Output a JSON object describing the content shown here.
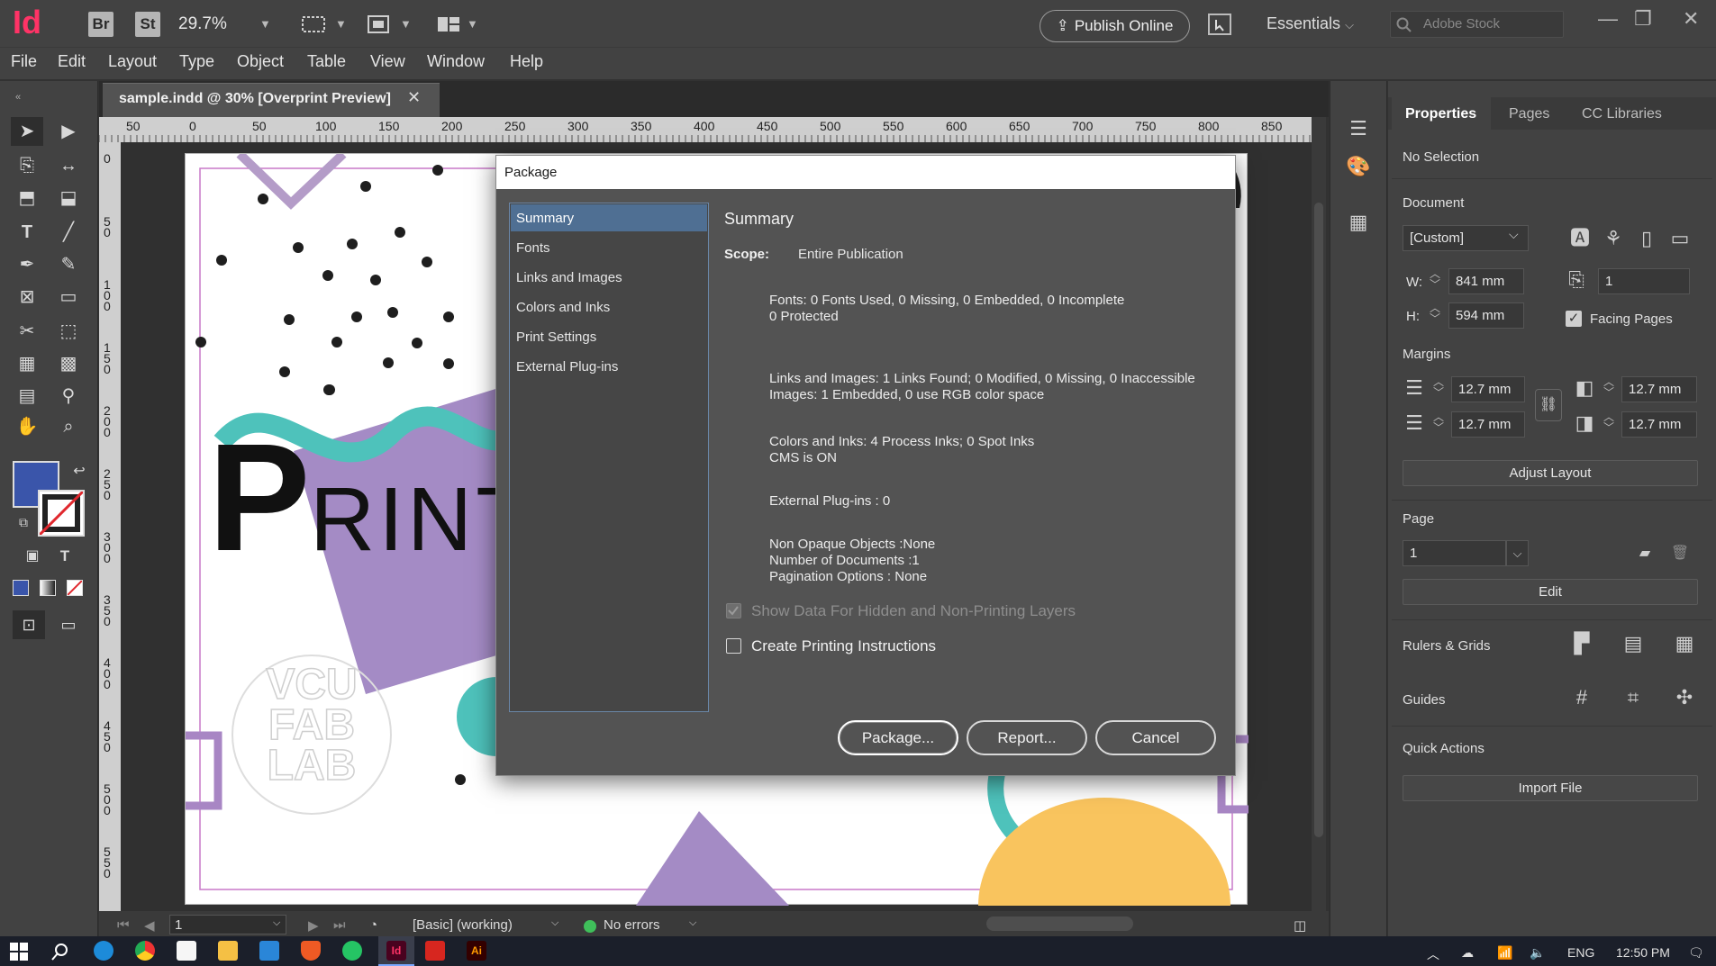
{
  "app": {
    "logo": "Id",
    "bridge": "Br",
    "stock_btn": "St",
    "zoom": "29.7%",
    "publish_online": "Publish Online",
    "workspace": "Essentials",
    "search_placeholder": "Adobe Stock"
  },
  "menu": [
    "File",
    "Edit",
    "Layout",
    "Type",
    "Object",
    "Table",
    "View",
    "Window",
    "Help"
  ],
  "document": {
    "tab_title": "sample.indd @ 30% [Overprint Preview]",
    "ruler_top": [
      "50",
      "0",
      "50",
      "100",
      "150",
      "200",
      "250",
      "300",
      "350",
      "400",
      "450",
      "500",
      "550",
      "600",
      "650",
      "700",
      "750",
      "800",
      "850"
    ],
    "ruler_left": [
      "0",
      "50",
      "100",
      "150",
      "200",
      "250",
      "300",
      "350",
      "400",
      "450",
      "500",
      "550"
    ],
    "artwork_text_print": "PRINT",
    "artwork_text_logo": [
      "VCU",
      "FAB",
      "LAB"
    ]
  },
  "status": {
    "page": "1",
    "style": "[Basic] (working)",
    "errors": "No errors"
  },
  "properties": {
    "tabs": [
      "Properties",
      "Pages",
      "CC Libraries"
    ],
    "selection": "No Selection",
    "document_label": "Document",
    "preset": "[Custom]",
    "w_label": "W:",
    "w_value": "841 mm",
    "h_label": "H:",
    "h_value": "594 mm",
    "pages_value": "1",
    "facing_pages": "Facing Pages",
    "margins_label": "Margins",
    "margin_top": "12.7 mm",
    "margin_bottom": "12.7 mm",
    "margin_left": "12.7 mm",
    "margin_right": "12.7 mm",
    "adjust_layout": "Adjust Layout",
    "page_label": "Page",
    "page_value": "1",
    "edit": "Edit",
    "rulers_grids": "Rulers & Grids",
    "guides": "Guides",
    "quick_actions": "Quick Actions",
    "import_file": "Import File"
  },
  "dialog": {
    "title": "Package",
    "nav": [
      "Summary",
      "Fonts",
      "Links and Images",
      "Colors and Inks",
      "Print Settings",
      "External Plug-ins"
    ],
    "heading": "Summary",
    "scope_label": "Scope:",
    "scope_value": "Entire Publication",
    "lines": [
      "Fonts: 0 Fonts Used, 0 Missing, 0 Embedded, 0 Incomplete",
      "0 Protected",
      "Links and Images: 1 Links Found; 0 Modified, 0 Missing, 0 Inaccessible",
      "Images: 1 Embedded, 0 use RGB color space",
      "Colors and Inks: 4 Process Inks; 0 Spot Inks",
      "CMS is ON",
      "External Plug-ins : 0",
      "Non Opaque Objects :None",
      "Number of Documents :1",
      "Pagination Options : None"
    ],
    "checkbox_hidden": "Show Data For Hidden and Non-Printing Layers",
    "checkbox_instructions": "Create Printing Instructions",
    "btn_package": "Package...",
    "btn_report": "Report...",
    "btn_cancel": "Cancel"
  },
  "taskbar": {
    "lang": "ENG",
    "time": "12:50 PM"
  }
}
